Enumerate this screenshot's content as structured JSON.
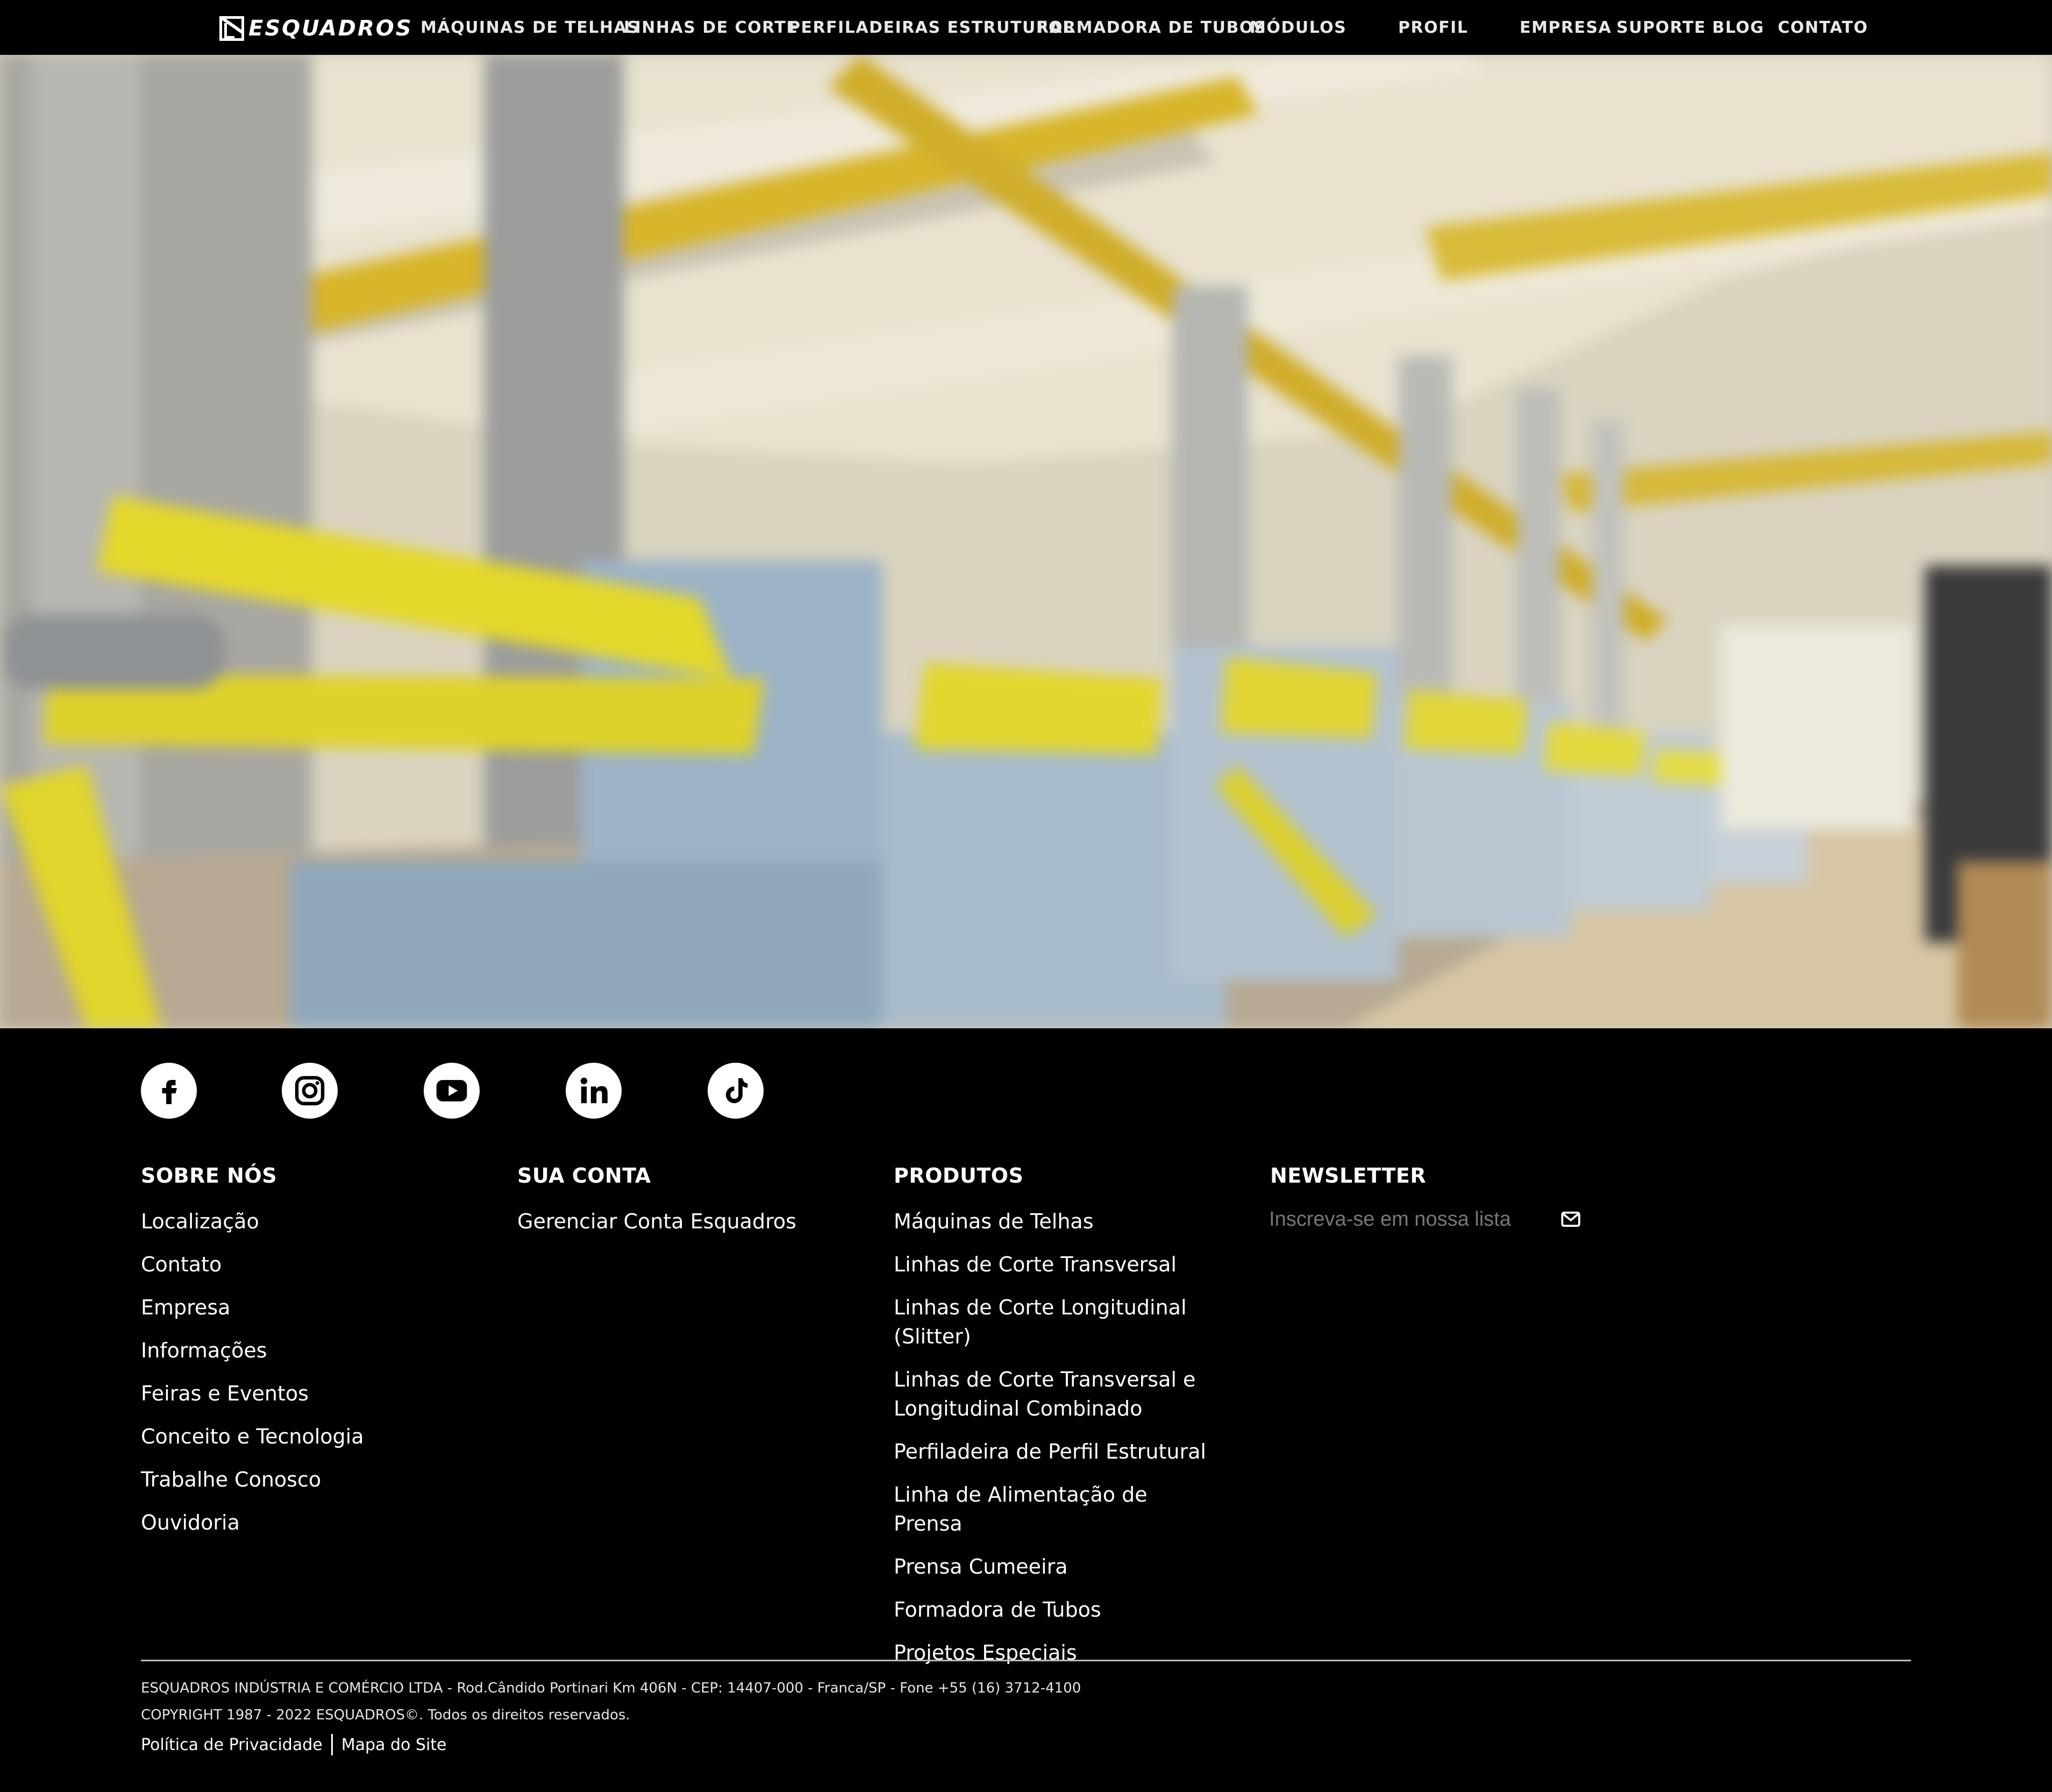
{
  "brand": {
    "logo_text": "ESQUADROS"
  },
  "nav": {
    "items": [
      {
        "label": "MÁQUINAS DE TELHAS"
      },
      {
        "label": "LINHAS DE CORTE"
      },
      {
        "label": "PERFILADEIRAS ESTRUTURAL"
      },
      {
        "label": "FORMADORA DE TUBOS"
      },
      {
        "label": "MÓDULOS"
      },
      {
        "label": "PROFIL"
      },
      {
        "label": "EMPRESA"
      },
      {
        "label": "SUPORTE"
      },
      {
        "label": "BLOG"
      },
      {
        "label": "CONTATO"
      }
    ]
  },
  "hero": {
    "image": "blurred factory floor with yellow and blue roll-forming machines"
  },
  "social": {
    "icons": [
      "facebook-icon",
      "instagram-icon",
      "youtube-icon",
      "linkedin-icon",
      "tiktok-icon"
    ]
  },
  "footer": {
    "about": {
      "heading": "SOBRE NÓS",
      "links": [
        "Localização",
        "Contato",
        "Empresa",
        "Informações",
        "Feiras e Eventos",
        "Conceito e Tecnologia",
        "Trabalhe Conosco",
        "Ouvidoria"
      ]
    },
    "account": {
      "heading": "SUA CONTA",
      "links": [
        "Gerenciar Conta Esquadros"
      ]
    },
    "products": {
      "heading": "PRODUTOS",
      "links": [
        "Máquinas de Telhas",
        "Linhas de Corte Transversal",
        "Linhas de Corte Longitudinal (Slitter)",
        "Linhas de Corte Transversal e Longitudinal Combinado",
        "Perfiladeira de Perfil Estrutural",
        "Linha de Alimentação de Prensa",
        "Prensa Cumeeira",
        "Formadora de Tubos",
        "Projetos Especiais"
      ]
    },
    "newsletter": {
      "heading": "NEWSLETTER",
      "placeholder": "Inscreva-se em nossa lista"
    },
    "legal": {
      "company": "ESQUADROS INDÚSTRIA E COMÉRCIO LTDA - Rod.Cândido Portinari Km 406N - CEP: 14407-000 - Franca/SP - Fone +55 (16) 3712-4100",
      "copyright": "COPYRIGHT 1987 - 2022 ESQUADROS©. Todos os direitos reservados.",
      "privacy": "Política de Privacidade",
      "sitemap": "Mapa do Site"
    }
  },
  "colors": {
    "background": "#000000",
    "text": "#ffffff",
    "accent_yellow": "#e8d83a",
    "machine_blue": "#9fb4c8"
  }
}
